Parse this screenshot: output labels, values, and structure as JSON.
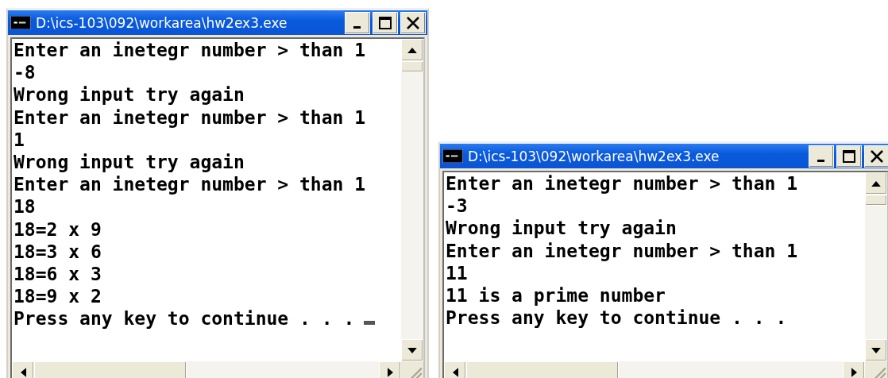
{
  "windows": [
    {
      "title": "D:\\ics-103\\092\\workarea\\hw2ex3.exe",
      "cursor": true,
      "lines": [
        "Enter an inetegr number > than 1",
        "-8",
        "Wrong input try again",
        "Enter an inetegr number > than 1",
        "1",
        "Wrong input try again",
        "Enter an inetegr number > than 1",
        "18",
        "18=2 x 9",
        "18=3 x 6",
        "18=6 x 3",
        "18=9 x 2",
        "Press any key to continue . . ."
      ]
    },
    {
      "title": "D:\\ics-103\\092\\workarea\\hw2ex3.exe",
      "cursor": false,
      "lines": [
        "Enter an inetegr number > than 1",
        "-3",
        "Wrong input try again",
        "Enter an inetegr number > than 1",
        "11",
        "11 is a prime number",
        "Press any key to continue . . ."
      ]
    }
  ]
}
